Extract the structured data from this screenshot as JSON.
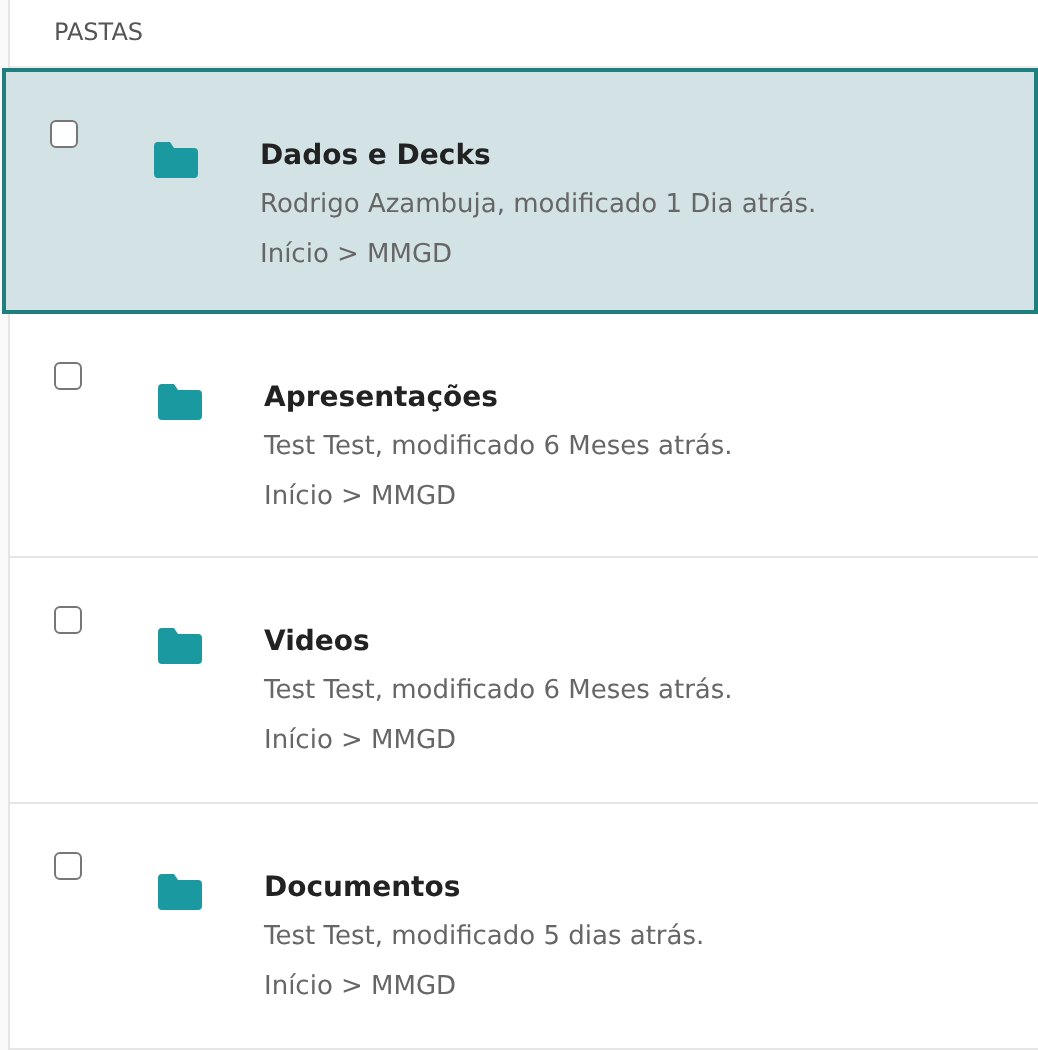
{
  "section_title": "PASTAS",
  "folders": [
    {
      "name": "Dados e Decks",
      "meta": "Rodrigo Azambuja, modificado 1 Dia atrás.",
      "path": "Início > MMGD",
      "selected": true,
      "checked": false
    },
    {
      "name": "Apresentações",
      "meta": "Test Test, modificado 6 Meses atrás.",
      "path": "Início > MMGD",
      "selected": false,
      "checked": false
    },
    {
      "name": "Videos",
      "meta": "Test Test, modificado 6 Meses atrás.",
      "path": "Início > MMGD",
      "selected": false,
      "checked": false
    },
    {
      "name": "Documentos",
      "meta": "Test Test, modificado 5 dias atrás.",
      "path": "Início > MMGD",
      "selected": false,
      "checked": false
    }
  ]
}
